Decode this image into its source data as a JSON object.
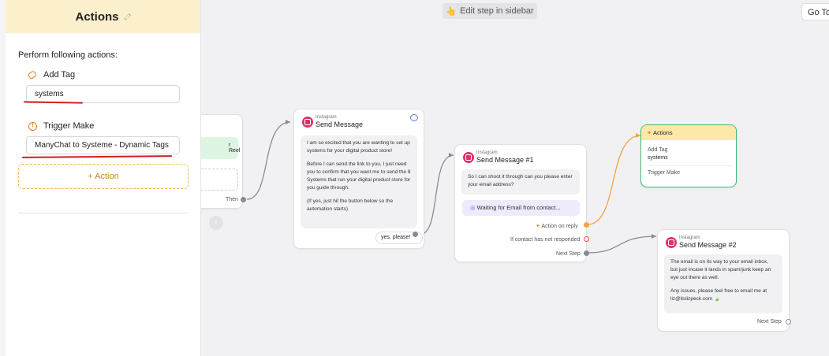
{
  "sidebar": {
    "title": "Actions",
    "instruction": "Perform following actions:",
    "actions": [
      {
        "label": "Add Tag",
        "value": "systems"
      },
      {
        "label": "Trigger Make",
        "value": "ManyChat to Systeme - Dynamic Tags"
      }
    ],
    "add_action_label": "+ Action"
  },
  "top_hint": "Edit step in sidebar",
  "goto_label": "Go To",
  "nodes": {
    "partial": {
      "text": "r Reel",
      "port_label": "Then"
    },
    "msg1": {
      "platform": "Instagram",
      "title": "Send Message",
      "paragraphs": [
        "I am so excited that you are wanting to set up systems for your digital product store!",
        "Before I can send the link to you, I just need you to confirm that you want me to send the 8 Systems that run your digital product store for you guide through.",
        "(If yes, just hit the button below so the automation starts)"
      ],
      "button": "yes, please!"
    },
    "msg2": {
      "platform": "Instagram",
      "title": "Send Message #1",
      "text": "So I can shoot it through can you please enter your email address?",
      "waiting": "Waiting for Email from contact...",
      "action_on_reply": "Action on reply",
      "no_response": "If contact has not responded",
      "next_step": "Next Step"
    },
    "actions": {
      "title": "Actions",
      "tag_label": "Add Tag",
      "tag_value": "systems",
      "trigger": "Trigger Make"
    },
    "msg3": {
      "platform": "Instagram",
      "title": "Send Message #2",
      "paragraphs": [
        "The email is on its way to your email inbox, but just incase it lands in spam/junk keep an eye out there as well.",
        "Any issues, please feel free to email me at liz@itslizpeck.com"
      ],
      "next_step": "Next Step"
    }
  },
  "colors": {
    "accent": "#f0a63d",
    "instagram": "#e1306c",
    "actions_border": "#3dbb6e",
    "underline": "#d11f1f"
  }
}
